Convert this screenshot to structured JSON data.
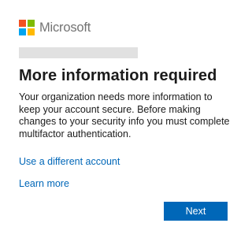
{
  "brand": {
    "name": "Microsoft",
    "logo_colors": [
      "#f25022",
      "#7fba00",
      "#00a4ef",
      "#ffb900"
    ]
  },
  "account": {
    "display": "(obscured account name)"
  },
  "title": "More information required",
  "description": "Your organization needs more information to keep your account secure. Before making changes to your security info you must complete multifactor authentication.",
  "links": {
    "different_account": "Use a different account",
    "learn_more": "Learn more"
  },
  "buttons": {
    "next": "Next"
  },
  "colors": {
    "accent": "#0067b8",
    "text": "#1b1b1b",
    "brand_text": "#737373"
  }
}
